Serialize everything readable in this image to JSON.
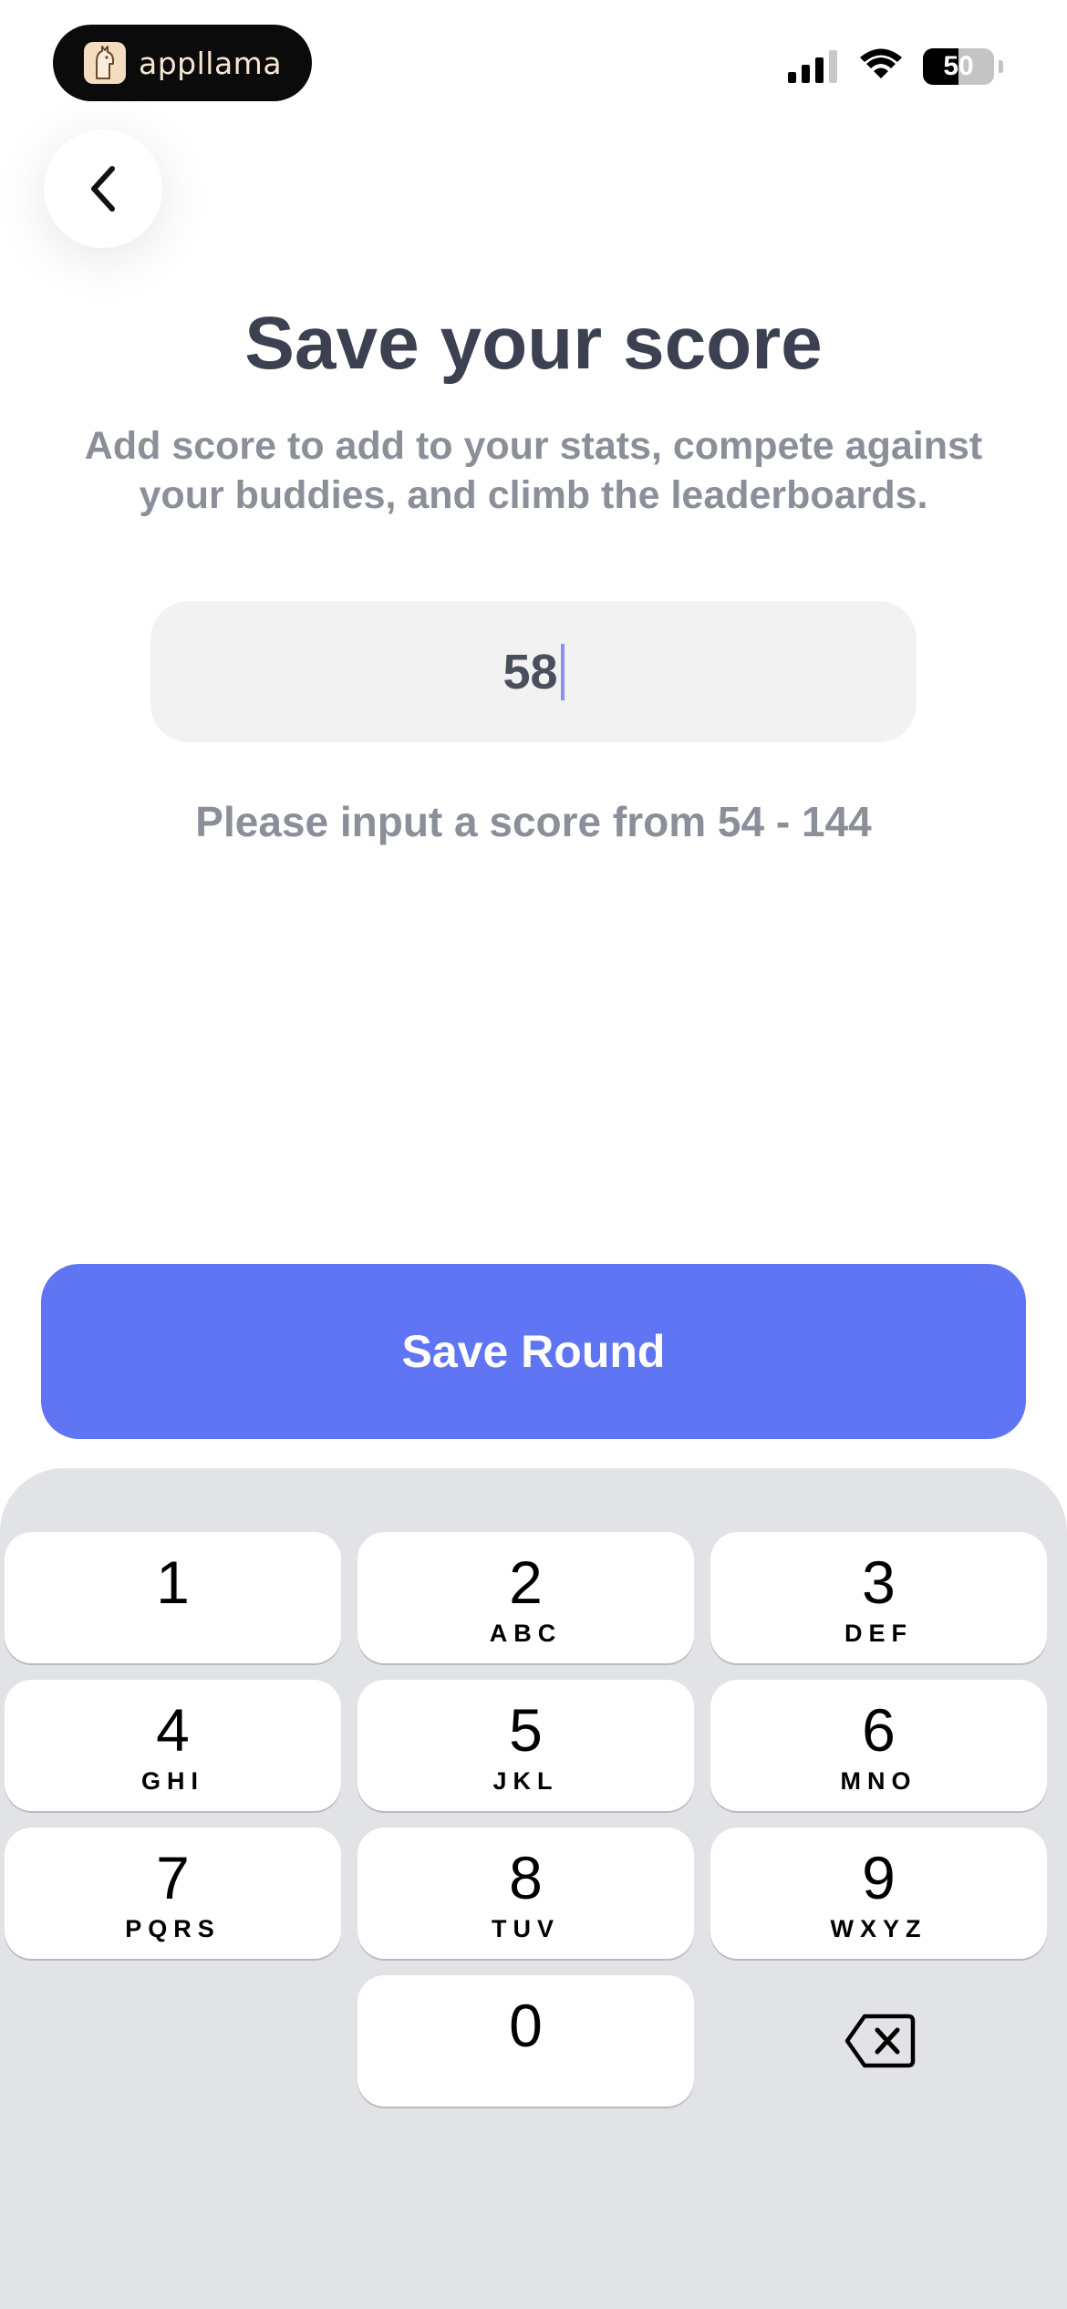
{
  "status_bar": {
    "brand_name": "appllama",
    "battery_level": "50",
    "battery_percent": 50
  },
  "icons": {
    "back": "chevron-left-icon",
    "signal": "cellular-signal-icon",
    "wifi": "wifi-icon",
    "battery": "battery-icon",
    "logo": "llama-logo-icon",
    "delete": "backspace-icon"
  },
  "header": {
    "title": "Save your score",
    "subtitle": "Add score to add to your stats, compete against your buddies, and climb the leaderboards."
  },
  "score_input": {
    "value": "58",
    "hint": "Please input a score from 54 - 144"
  },
  "actions": {
    "save_label": "Save Round"
  },
  "keypad": {
    "keys": [
      {
        "digit": "1",
        "letters": ""
      },
      {
        "digit": "2",
        "letters": "ABC"
      },
      {
        "digit": "3",
        "letters": "DEF"
      },
      {
        "digit": "4",
        "letters": "GHI"
      },
      {
        "digit": "5",
        "letters": "JKL"
      },
      {
        "digit": "6",
        "letters": "MNO"
      },
      {
        "digit": "7",
        "letters": "PQRS"
      },
      {
        "digit": "8",
        "letters": "TUV"
      },
      {
        "digit": "9",
        "letters": "WXYZ"
      },
      {
        "digit": "0",
        "letters": ""
      }
    ]
  },
  "colors": {
    "accent": "#5f75f3",
    "title": "#3b4150",
    "muted": "#8a8f99",
    "input_bg": "#f2f2f3",
    "keypad_bg": "#e2e3e6"
  }
}
